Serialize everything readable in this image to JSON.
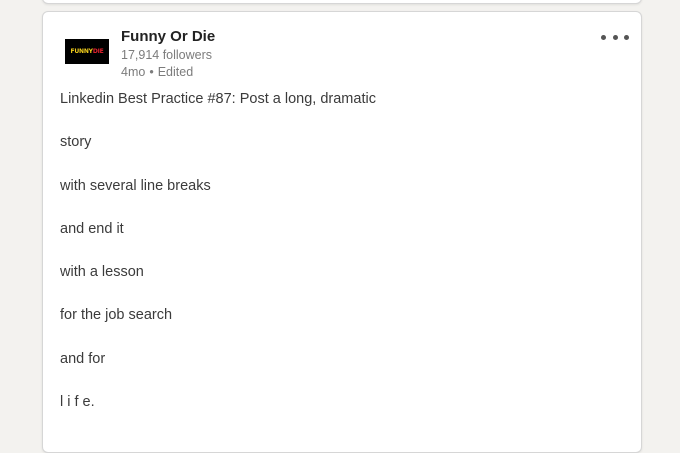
{
  "post": {
    "author": {
      "name": "Funny Or Die",
      "followers": "17,914 followers",
      "age": "4mo",
      "separator": "•",
      "edited": "Edited",
      "logo_text_left": "FUNNY",
      "logo_text_right": "DIE"
    },
    "more_icon": "ellipsis-icon",
    "lines": [
      "Linkedin Best Practice #87: Post a long, dramatic",
      "story",
      "with several line breaks",
      "and end it",
      "with a lesson",
      "for the job search",
      "and for",
      "l i f e."
    ]
  },
  "colors": {
    "background": "#f3f2ef",
    "card": "#ffffff",
    "logo_bg": "#000000",
    "logo_yellow": "#f6d11c",
    "logo_red": "#e4222f"
  }
}
